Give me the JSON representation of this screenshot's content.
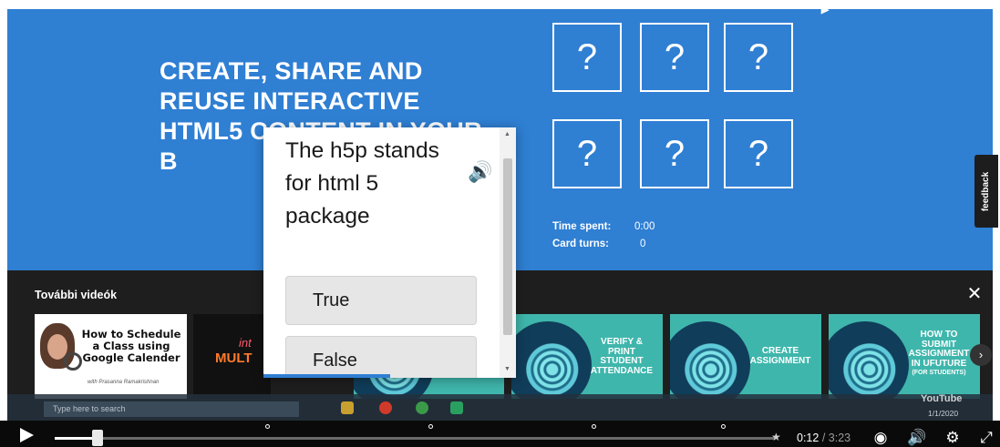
{
  "slide": {
    "headline": "CREATE, SHARE AND REUSE INTERACTIVE HTML5 CONTENT IN YOUR B",
    "cards": [
      "?",
      "?",
      "?",
      "?",
      "?",
      "?"
    ],
    "time_spent_label": "Time spent:",
    "time_spent_value": "0:00",
    "card_turns_label": "Card turns:",
    "card_turns_value": "0",
    "feedback_label": "feedback"
  },
  "more_videos": {
    "title": "További videók",
    "close": "✕",
    "next": "›",
    "items": [
      {
        "title": "How to Schedule a Class using Google Calender",
        "subtitle": "with Prasanna Ramakrishnan"
      },
      {
        "title_line1": "int",
        "title_line2": "MULT"
      },
      {
        "title": ""
      },
      {
        "title": "VERIFY & PRINT STUDENT ATTENDANCE"
      },
      {
        "title": "CREATE ASSIGNMENT"
      },
      {
        "title": "HOW TO SUBMIT ASSIGNMENT IN UFUTURE",
        "subtitle": "(FOR STUDENTS)"
      }
    ]
  },
  "taskbar": {
    "search_placeholder": "Type here to search",
    "date": "1/1/2020",
    "logo": "YouTube"
  },
  "popup": {
    "question": "The h5p stands for html 5 package",
    "answers": [
      "True",
      "False"
    ],
    "audio_icon": "speaker-icon",
    "progress": 0.5
  },
  "player": {
    "current_time": "0:12",
    "separator": " / ",
    "duration": "3:23",
    "progress": 0.06,
    "icons": [
      "play-icon",
      "speed-icon",
      "volume-icon",
      "settings-icon",
      "fullscreen-icon"
    ]
  },
  "colors": {
    "slide_blue": "#2f7fd3",
    "teal": "#3fb6ac",
    "band": "#1e1e1e"
  }
}
